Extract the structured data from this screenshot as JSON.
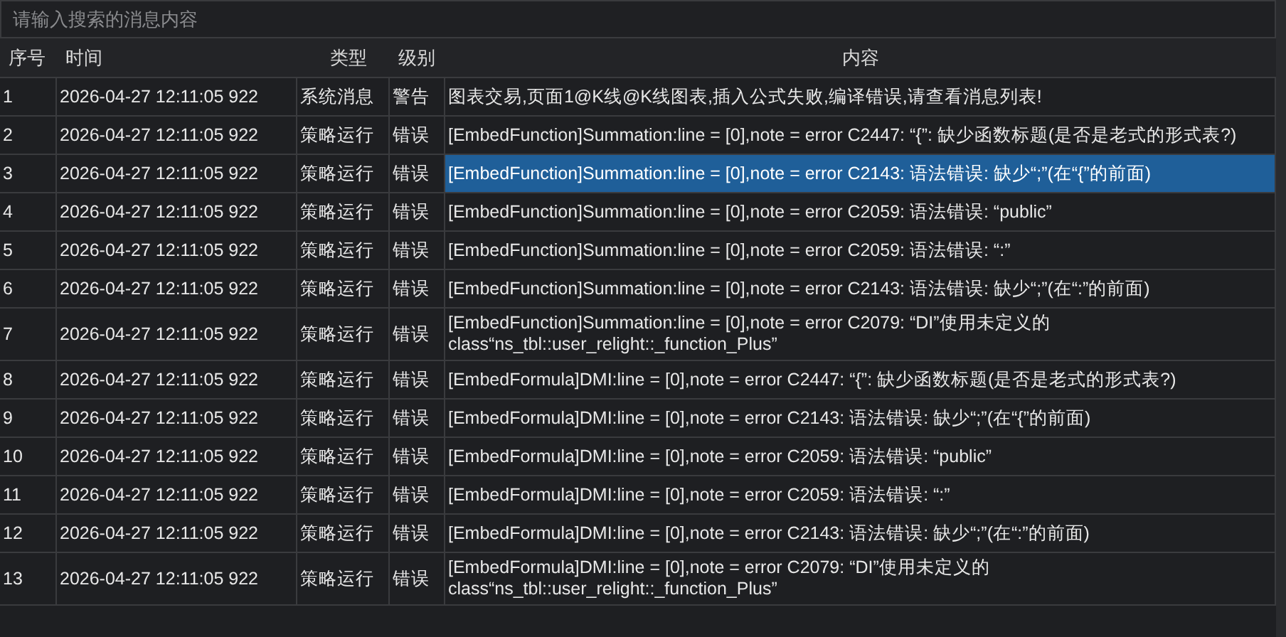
{
  "search": {
    "placeholder": "请输入搜索的消息内容"
  },
  "table": {
    "columns": [
      "序号",
      "时间",
      "类型",
      "级别",
      "内容"
    ],
    "rows": [
      {
        "index": "1",
        "time": "2026-04-27 12:11:05 922",
        "type": "系统消息",
        "level": "警告",
        "content": "图表交易,页面1@K线@K线图表,插入公式失败,编译错误,请查看消息列表!",
        "selected": false
      },
      {
        "index": "2",
        "time": "2026-04-27 12:11:05 922",
        "type": "策略运行",
        "level": "错误",
        "content": "[EmbedFunction]Summation:line = [0],note = error C2447: “{”: 缺少函数标题(是否是老式的形式表?)",
        "selected": false
      },
      {
        "index": "3",
        "time": "2026-04-27 12:11:05 922",
        "type": "策略运行",
        "level": "错误",
        "content": "[EmbedFunction]Summation:line = [0],note = error C2143: 语法错误: 缺少“;”(在“{”的前面)",
        "selected": true
      },
      {
        "index": "4",
        "time": "2026-04-27 12:11:05 922",
        "type": "策略运行",
        "level": "错误",
        "content": "[EmbedFunction]Summation:line = [0],note = error C2059: 语法错误: “public”",
        "selected": false
      },
      {
        "index": "5",
        "time": "2026-04-27 12:11:05 922",
        "type": "策略运行",
        "level": "错误",
        "content": "[EmbedFunction]Summation:line = [0],note = error C2059: 语法错误: “:”",
        "selected": false
      },
      {
        "index": "6",
        "time": "2026-04-27 12:11:05 922",
        "type": "策略运行",
        "level": "错误",
        "content": "[EmbedFunction]Summation:line = [0],note = error C2143: 语法错误: 缺少“;”(在“:”的前面)",
        "selected": false
      },
      {
        "index": "7",
        "time": "2026-04-27 12:11:05 922",
        "type": "策略运行",
        "level": "错误",
        "content": "[EmbedFunction]Summation:line = [0],note = error C2079: “DI”使用未定义的 class“ns_tbl::user_relight::_function_Plus”",
        "selected": false
      },
      {
        "index": "8",
        "time": "2026-04-27 12:11:05 922",
        "type": "策略运行",
        "level": "错误",
        "content": "[EmbedFormula]DMI:line = [0],note = error C2447: “{”: 缺少函数标题(是否是老式的形式表?)",
        "selected": false
      },
      {
        "index": "9",
        "time": "2026-04-27 12:11:05 922",
        "type": "策略运行",
        "level": "错误",
        "content": "[EmbedFormula]DMI:line = [0],note = error C2143: 语法错误: 缺少“;”(在“{”的前面)",
        "selected": false
      },
      {
        "index": "10",
        "time": "2026-04-27 12:11:05 922",
        "type": "策略运行",
        "level": "错误",
        "content": "[EmbedFormula]DMI:line = [0],note = error C2059: 语法错误: “public”",
        "selected": false
      },
      {
        "index": "11",
        "time": "2026-04-27 12:11:05 922",
        "type": "策略运行",
        "level": "错误",
        "content": "[EmbedFormula]DMI:line = [0],note = error C2059: 语法错误: “:”",
        "selected": false
      },
      {
        "index": "12",
        "time": "2026-04-27 12:11:05 922",
        "type": "策略运行",
        "level": "错误",
        "content": "[EmbedFormula]DMI:line = [0],note = error C2143: 语法错误: 缺少“;”(在“:”的前面)",
        "selected": false
      },
      {
        "index": "13",
        "time": "2026-04-27 12:11:05 922",
        "type": "策略运行",
        "level": "错误",
        "content": "[EmbedFormula]DMI:line = [0],note = error C2079: “DI”使用未定义的 class“ns_tbl::user_relight::_function_Plus”",
        "selected": false
      }
    ]
  }
}
